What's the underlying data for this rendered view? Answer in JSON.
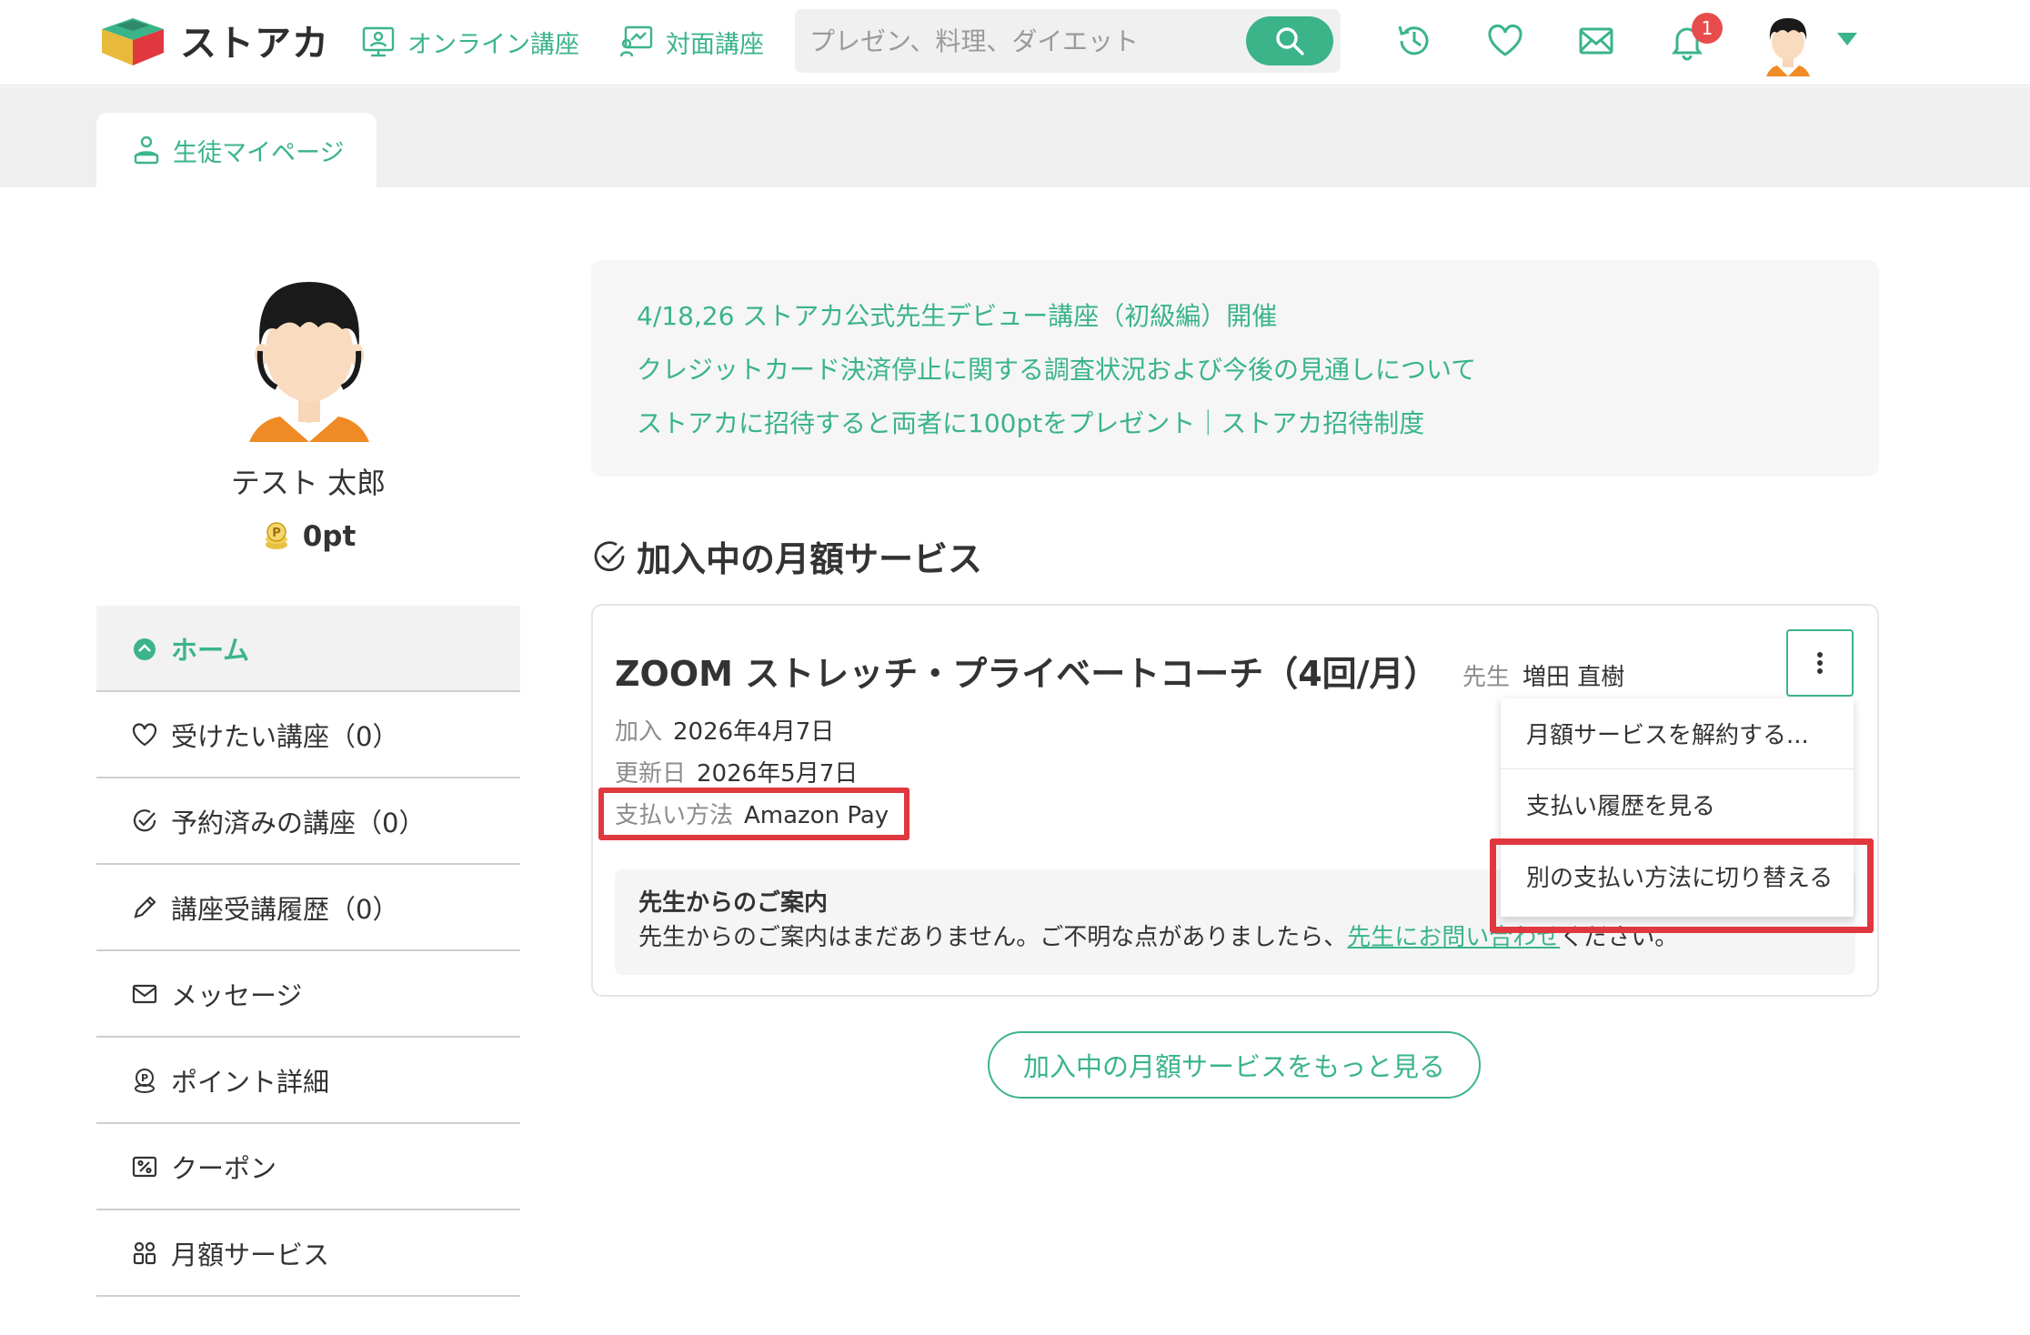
{
  "brand": {
    "name": "ストアカ",
    "accent": "#3bb48a",
    "highlight": "#e0383e"
  },
  "header": {
    "nav": [
      {
        "label": "オンライン講座",
        "icon": "monitor-person-icon"
      },
      {
        "label": "対面講座",
        "icon": "whiteboard-icon"
      }
    ],
    "search": {
      "placeholder": "プレゼン、料理、ダイエット",
      "value": ""
    },
    "icons": [
      "history-icon",
      "heart-icon",
      "mail-icon",
      "bell-icon"
    ],
    "notification_count": "1"
  },
  "tabs": [
    {
      "label": "生徒マイページ",
      "icon": "student-icon",
      "active": true
    }
  ],
  "profile": {
    "name": "テスト 太郎",
    "points": "0pt"
  },
  "sidebar": {
    "items": [
      {
        "label": "ホーム",
        "icon": "home-icon",
        "active": true
      },
      {
        "label": "受けたい講座（0）",
        "icon": "heart-icon"
      },
      {
        "label": "予約済みの講座（0）",
        "icon": "check-circle-icon"
      },
      {
        "label": "講座受講履歴（0）",
        "icon": "pencil-icon"
      },
      {
        "label": "メッセージ",
        "icon": "mail-icon"
      },
      {
        "label": "ポイント詳細",
        "icon": "point-coin-icon"
      },
      {
        "label": "クーポン",
        "icon": "coupon-icon"
      },
      {
        "label": "月額サービス",
        "icon": "group-icon"
      }
    ]
  },
  "notices": [
    "4/18,26 ストアカ公式先生デビュー講座（初級編）開催",
    "クレジットカード決済停止に関する調査状況および今後の見通しについて",
    "ストアカに招待すると両者に100ptをプレゼント｜ストアカ招待制度"
  ],
  "section": {
    "title": "加入中の月額サービス"
  },
  "subscription": {
    "title": "ZOOM ストレッチ・プライベートコーチ（4回/月）",
    "teacher_label": "先生",
    "teacher_name": "増田 直樹",
    "joined_label": "加入",
    "joined_date": "2026年4月7日",
    "renewal_label": "更新日",
    "renewal_date": "2026年5月7日",
    "payment_label": "支払い方法",
    "payment_value": "Amazon Pay",
    "teacher_notice_title": "先生からのご案内",
    "teacher_notice_text": "先生からのご案内はまだありません。ご不明な点がありましたら、",
    "teacher_notice_link": "先生にお問い合わせ",
    "teacher_notice_tail": "ください。"
  },
  "menu": {
    "items": [
      "月額サービスを解約する...",
      "支払い履歴を見る",
      "別の支払い方法に切り替える"
    ]
  },
  "more_button": "加入中の月額サービスをもっと見る"
}
